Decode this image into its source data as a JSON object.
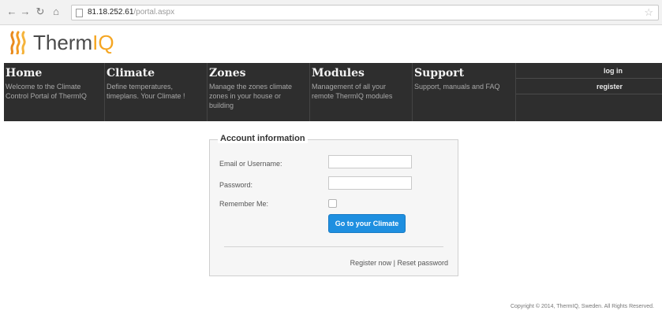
{
  "browser": {
    "address_host": "81.18.252.61",
    "address_path": "/portal.aspx"
  },
  "logo": {
    "text_main": "Therm",
    "text_accent": "IQ"
  },
  "nav": [
    {
      "title": "Home",
      "desc": "Welcome to the Climate Control Portal of ThermIQ"
    },
    {
      "title": "Climate",
      "desc": "Define temperatures, timeplans. Your Climate !"
    },
    {
      "title": "Zones",
      "desc": "Manage the zones climate zones in your house or building"
    },
    {
      "title": "Modules",
      "desc": "Management of all your remote ThermIQ modules"
    },
    {
      "title": "Support",
      "desc": "Support, manuals and FAQ"
    }
  ],
  "auth": {
    "login_label": "log in",
    "register_label": "register"
  },
  "login": {
    "legend": "Account information",
    "email_label": "Email or Username:",
    "password_label": "Password:",
    "remember_label": "Remember Me:",
    "submit_label": "Go to your Climate",
    "register_link": "Register now",
    "separator": " | ",
    "reset_link": "Reset password"
  },
  "footer": {
    "text": "Copyright © 2014, ThermIQ, Sweden. All Rights Reserved."
  }
}
